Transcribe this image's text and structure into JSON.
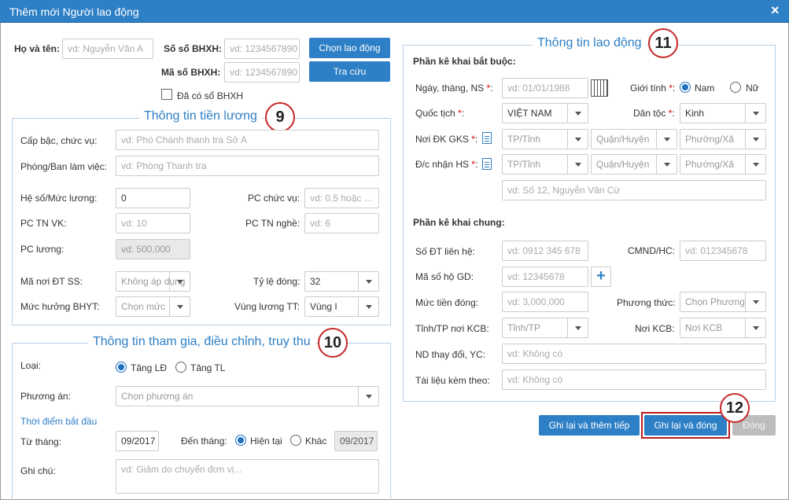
{
  "title": "Thêm mới Người lao động",
  "close_icon": "×",
  "top": {
    "ho_ten_label": "Họ và tên:",
    "ho_ten_ph": "vd: Nguyễn Văn A",
    "so_bhxh_label": "Số sổ BHXH:",
    "so_bhxh_ph": "vd: 1234567890",
    "ma_bhxh_label": "Mã số BHXH:",
    "ma_bhxh_ph": "vd: 1234567890",
    "chon_btn": "Chọn lao động",
    "tra_cuu_btn": "Tra cứu",
    "da_co_label": "Đã có sổ BHXH"
  },
  "luong": {
    "legend": "Thông tin tiền lương",
    "badge": "9",
    "cap_bac_label": "Cấp bậc, chức vụ:",
    "cap_bac_ph": "vd: Phó Chánh thanh tra Sở A",
    "phong_label": "Phòng/Ban làm việc:",
    "phong_ph": "vd: Phòng Thanh tra",
    "he_so_label": "Hệ số/Mức lương:",
    "he_so_val": "0",
    "pc_cv_label": "PC chức vụ:",
    "pc_cv_ph": "vd: 0.5 hoặc ...",
    "pc_tnvk_label": "PC TN VK:",
    "pc_tnvk_ph": "vd: 10",
    "pc_tnn_label": "PC TN nghề:",
    "pc_tnn_ph": "vd: 6",
    "pc_luong_label": "PC lương:",
    "pc_luong_ph": "vd: 500,000",
    "ma_noi_label": "Mã nơi ĐT SS:",
    "ma_noi_val": "Không áp dụng",
    "ty_le_label": "Tỷ lệ đóng:",
    "ty_le_val": "32",
    "muc_bhyt_label": "Mức hưởng BHYT:",
    "muc_bhyt_val": "Chọn mức",
    "vung_label": "Vùng lương TT:",
    "vung_val": "Vùng I"
  },
  "thamgia": {
    "legend": "Thông tin tham gia, điều chỉnh, truy thu",
    "badge": "10",
    "loai_label": "Loại:",
    "tang_ld": "Tăng LĐ",
    "tang_tl": "Tăng TL",
    "phuong_an_label": "Phương án:",
    "phuong_an_val": "Chọn phương án",
    "thoi_diem": "Thời điểm bắt đầu",
    "tu_thang_label": "Từ tháng:",
    "tu_thang_val": "09/2017",
    "den_thang_label": "Đến tháng:",
    "hien_tai": "Hiện tại",
    "khac": "Khác",
    "den_val": "09/2017",
    "ghi_chu_label": "Ghi chú:",
    "ghi_chu_ph": "vd: Giảm do chuyển đơn vị..."
  },
  "laodong": {
    "legend": "Thông tin lao động",
    "badge": "11",
    "bat_buoc": "Phần kê khai bắt buộc:",
    "ngay_sinh_label": "Ngày, tháng, NS",
    "ngay_sinh_ph": "vd: 01/01/1988",
    "gioi_tinh_label": "Giới tính",
    "nam": "Nam",
    "nu": "Nữ",
    "quoc_tich_label": "Quốc tịch",
    "quoc_tich_val": "VIỆT NAM",
    "dan_toc_label": "Dân tộc",
    "dan_toc_val": "Kinh",
    "noi_dk_label": "Nơi ĐK GKS",
    "dc_nhan_label": "Đ/c nhận HS",
    "tinh_ph": "TP/Tỉnh",
    "huyen_ph": "Quận/Huyện",
    "xa_ph": "Phường/Xã",
    "dia_chi_ph": "vd: Số 12, Nguyễn Văn Cừ",
    "chung": "Phần kê khai chung:",
    "sdt_label": "Số ĐT liên hệ:",
    "sdt_ph": "vd: 0912 345 678",
    "cmnd_label": "CMND/HC:",
    "cmnd_ph": "vd: 012345678",
    "ma_ho_label": "Mã số hộ GD:",
    "ma_ho_ph": "vd: 12345678",
    "plus": "+",
    "muc_tien_label": "Mức tiền đóng:",
    "muc_tien_ph": "vd: 3,000,000",
    "phuong_thuc_label": "Phương thức:",
    "phuong_thuc_val": "Chọn Phương",
    "tinh_kcb_label": "Tỉnh/TP nơi KCB:",
    "tinh_kcb_val": "Tỉnh/TP",
    "noi_kcb_label": "Nơi KCB:",
    "noi_kcb_val": "Nơi KCB",
    "nd_label": "ND thay đổi, YC:",
    "nd_ph": "vd: Không có",
    "tai_lieu_label": "Tài liệu kèm theo:",
    "tai_lieu_ph": "vd: Không có"
  },
  "actions": {
    "ghi_them": "Ghi lại và thêm tiếp",
    "ghi_dong": "Ghi lại và đóng",
    "dong": "Đóng",
    "badge": "12"
  },
  "req_star": "*"
}
